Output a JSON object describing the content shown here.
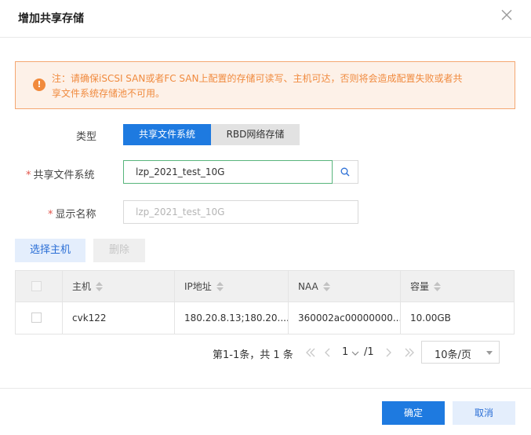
{
  "dialog": {
    "title": "增加共享存储",
    "close_icon": "close-icon"
  },
  "notice": {
    "icon": "exclamation-icon",
    "text": "注：请确保iSCSI SAN或者FC SAN上配置的存储可读写、主机可达，否则将会造成配置失败或者共享文件系统存储池不可用。",
    "line1": "注：请确保iSCSI SAN或者FC SAN上配置的存储可读写、主机可达，否则将会造成配置失败或者共",
    "line2": "享文件系统存储池不可用。",
    "color": "#f08a3e"
  },
  "form": {
    "type_label": "类型",
    "type_options": [
      "共享文件系统",
      "RBD网络存储"
    ],
    "type_selected": "共享文件系统",
    "fs_label": "共享文件系统",
    "fs_value": "lzp_2021_test_10G",
    "display_name_label": "显示名称",
    "display_name_placeholder": "lzp_2021_test_10G",
    "required_mark": "*"
  },
  "actions": {
    "select_host": "选择主机",
    "delete": "删除"
  },
  "table": {
    "columns": [
      "主机",
      "IP地址",
      "NAA",
      "容量"
    ],
    "rows": [
      {
        "host": "cvk122",
        "ip": "180.20.8.13;180.20....",
        "naa": "360002ac00000000...",
        "capacity": "10.00GB"
      }
    ]
  },
  "pagination": {
    "summary": "第1-1条，共 1 条",
    "current_page": "1",
    "total_pages": "/1",
    "page_size": "10条/页"
  },
  "footer": {
    "confirm": "确定",
    "cancel": "取消"
  },
  "colors": {
    "primary": "#1e7ae0",
    "warning_border": "#f4a771",
    "warning_bg": "#fdf1e8"
  }
}
